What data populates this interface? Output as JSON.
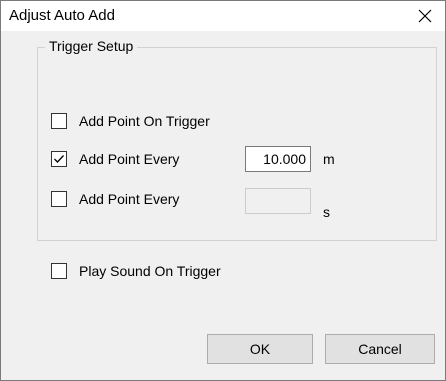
{
  "window": {
    "title": "Adjust Auto Add"
  },
  "group": {
    "title": "Trigger Setup"
  },
  "options": {
    "add_on_trigger": {
      "label": "Add Point On Trigger",
      "checked": false
    },
    "add_every_distance": {
      "label": "Add Point Every",
      "checked": true,
      "value": "10.000",
      "unit": "m"
    },
    "add_every_time": {
      "label": "Add Point Every",
      "checked": false,
      "value": "",
      "unit": "s"
    }
  },
  "sound": {
    "label": "Play Sound On Trigger",
    "checked": false
  },
  "buttons": {
    "ok": "OK",
    "cancel": "Cancel"
  },
  "icons": {
    "close": "close-icon",
    "check": "checkmark-icon"
  }
}
